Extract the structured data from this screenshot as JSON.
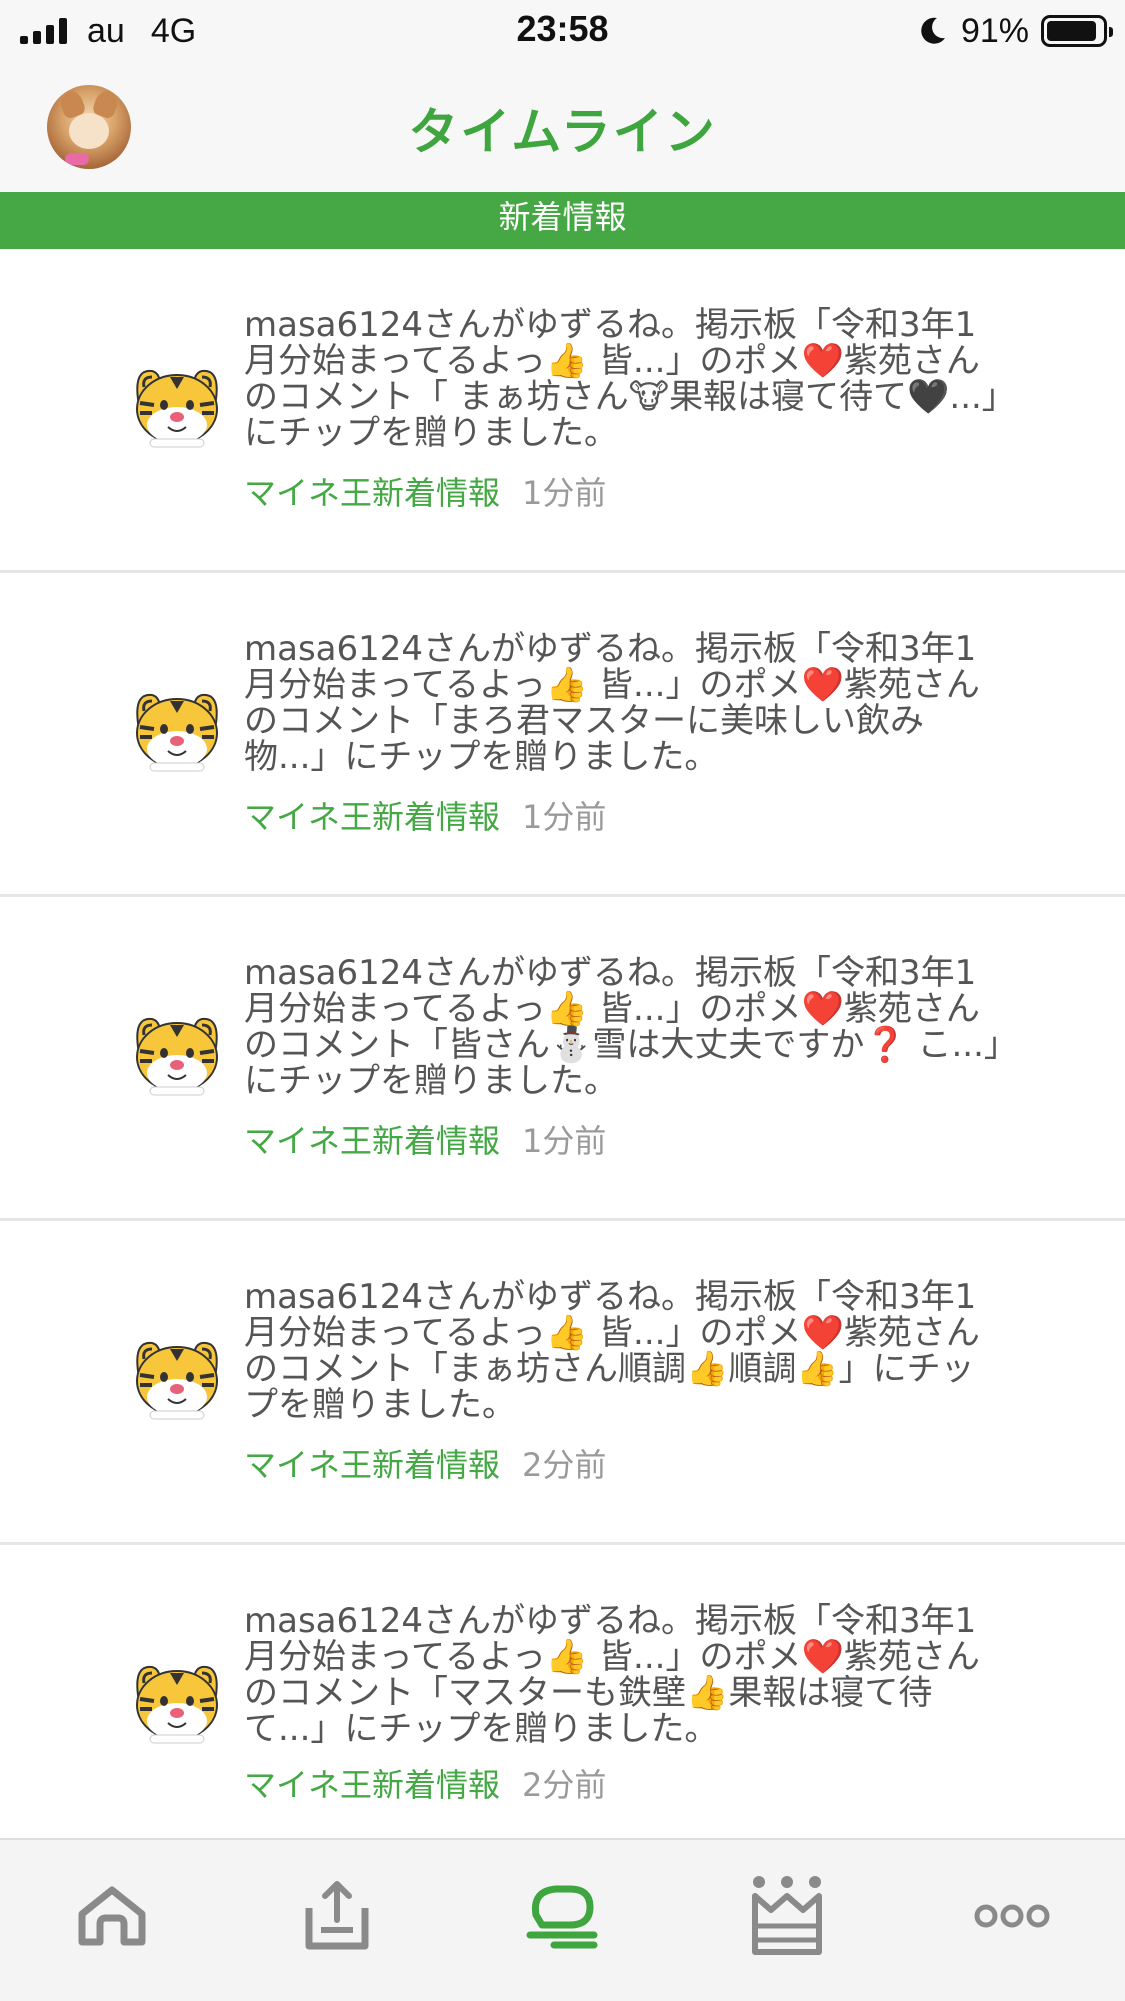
{
  "status_bar": {
    "carrier": "au",
    "network": "4G",
    "time": "23:58",
    "battery": "91%",
    "battery_level": 0.91
  },
  "header": {
    "title": "タイムライン",
    "avatar_icon": "user-avatar"
  },
  "section": {
    "label": "新着情報",
    "color": "#45a845"
  },
  "timeline": [
    {
      "text": "masa6124さんがゆずるね。掲示板「令和3年1月分始まってるよっ👍 皆...」のポメ❤️紫苑さんのコメント「 まぁ坊さん🐮果報は寝て待て🖤...」にチップを贈りました。",
      "source": "マイネ王新着情報",
      "time": "1分前"
    },
    {
      "text": "masa6124さんがゆずるね。掲示板「令和3年1月分始まってるよっ👍 皆...」のポメ❤️紫苑さんのコメント「まろ君マスターに美味しい飲み物...」にチップを贈りました。",
      "source": "マイネ王新着情報",
      "time": "1分前"
    },
    {
      "text": "masa6124さんがゆずるね。掲示板「令和3年1月分始まってるよっ👍 皆...」のポメ❤️紫苑さんのコメント「皆さん⛄雪は大丈夫ですか❓ こ...」にチップを贈りました。",
      "source": "マイネ王新着情報",
      "time": "1分前"
    },
    {
      "text": "masa6124さんがゆずるね。掲示板「令和3年1月分始まってるよっ👍 皆...」のポメ❤️紫苑さんのコメント「まぁ坊さん順調👍順調👍」にチップを贈りました。",
      "source": "マイネ王新着情報",
      "time": "2分前"
    },
    {
      "text": "masa6124さんがゆずるね。掲示板「令和3年1月分始まってるよっ👍 皆...」のポメ❤️紫苑さんのコメント「マスターも鉄壁👍果報は寝て待て...」にチップを贈りました。",
      "source": "マイネ王新着情報",
      "time": "2分前"
    }
  ],
  "tab_bar": {
    "tabs": [
      {
        "icon": "home-icon",
        "active": false
      },
      {
        "icon": "upload-icon",
        "active": false
      },
      {
        "icon": "timeline-chat-icon",
        "active": true
      },
      {
        "icon": "crown-icon",
        "active": false
      },
      {
        "icon": "more-icon",
        "active": false
      }
    ],
    "active_color": "#3fa63f",
    "inactive_color": "#8a8a8a"
  }
}
